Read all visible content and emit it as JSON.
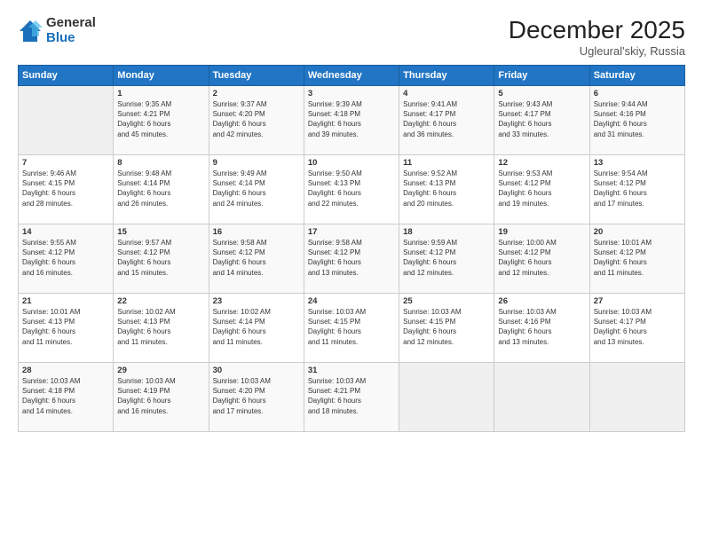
{
  "header": {
    "logo_general": "General",
    "logo_blue": "Blue",
    "title": "December 2025",
    "subtitle": "Ugleural'skiy, Russia"
  },
  "columns": [
    "Sunday",
    "Monday",
    "Tuesday",
    "Wednesday",
    "Thursday",
    "Friday",
    "Saturday"
  ],
  "rows": [
    [
      {
        "num": "",
        "info": ""
      },
      {
        "num": "1",
        "info": "Sunrise: 9:35 AM\nSunset: 4:21 PM\nDaylight: 6 hours\nand 45 minutes."
      },
      {
        "num": "2",
        "info": "Sunrise: 9:37 AM\nSunset: 4:20 PM\nDaylight: 6 hours\nand 42 minutes."
      },
      {
        "num": "3",
        "info": "Sunrise: 9:39 AM\nSunset: 4:18 PM\nDaylight: 6 hours\nand 39 minutes."
      },
      {
        "num": "4",
        "info": "Sunrise: 9:41 AM\nSunset: 4:17 PM\nDaylight: 6 hours\nand 36 minutes."
      },
      {
        "num": "5",
        "info": "Sunrise: 9:43 AM\nSunset: 4:17 PM\nDaylight: 6 hours\nand 33 minutes."
      },
      {
        "num": "6",
        "info": "Sunrise: 9:44 AM\nSunset: 4:16 PM\nDaylight: 6 hours\nand 31 minutes."
      }
    ],
    [
      {
        "num": "7",
        "info": "Sunrise: 9:46 AM\nSunset: 4:15 PM\nDaylight: 6 hours\nand 28 minutes."
      },
      {
        "num": "8",
        "info": "Sunrise: 9:48 AM\nSunset: 4:14 PM\nDaylight: 6 hours\nand 26 minutes."
      },
      {
        "num": "9",
        "info": "Sunrise: 9:49 AM\nSunset: 4:14 PM\nDaylight: 6 hours\nand 24 minutes."
      },
      {
        "num": "10",
        "info": "Sunrise: 9:50 AM\nSunset: 4:13 PM\nDaylight: 6 hours\nand 22 minutes."
      },
      {
        "num": "11",
        "info": "Sunrise: 9:52 AM\nSunset: 4:13 PM\nDaylight: 6 hours\nand 20 minutes."
      },
      {
        "num": "12",
        "info": "Sunrise: 9:53 AM\nSunset: 4:12 PM\nDaylight: 6 hours\nand 19 minutes."
      },
      {
        "num": "13",
        "info": "Sunrise: 9:54 AM\nSunset: 4:12 PM\nDaylight: 6 hours\nand 17 minutes."
      }
    ],
    [
      {
        "num": "14",
        "info": "Sunrise: 9:55 AM\nSunset: 4:12 PM\nDaylight: 6 hours\nand 16 minutes."
      },
      {
        "num": "15",
        "info": "Sunrise: 9:57 AM\nSunset: 4:12 PM\nDaylight: 6 hours\nand 15 minutes."
      },
      {
        "num": "16",
        "info": "Sunrise: 9:58 AM\nSunset: 4:12 PM\nDaylight: 6 hours\nand 14 minutes."
      },
      {
        "num": "17",
        "info": "Sunrise: 9:58 AM\nSunset: 4:12 PM\nDaylight: 6 hours\nand 13 minutes."
      },
      {
        "num": "18",
        "info": "Sunrise: 9:59 AM\nSunset: 4:12 PM\nDaylight: 6 hours\nand 12 minutes."
      },
      {
        "num": "19",
        "info": "Sunrise: 10:00 AM\nSunset: 4:12 PM\nDaylight: 6 hours\nand 12 minutes."
      },
      {
        "num": "20",
        "info": "Sunrise: 10:01 AM\nSunset: 4:12 PM\nDaylight: 6 hours\nand 11 minutes."
      }
    ],
    [
      {
        "num": "21",
        "info": "Sunrise: 10:01 AM\nSunset: 4:13 PM\nDaylight: 6 hours\nand 11 minutes."
      },
      {
        "num": "22",
        "info": "Sunrise: 10:02 AM\nSunset: 4:13 PM\nDaylight: 6 hours\nand 11 minutes."
      },
      {
        "num": "23",
        "info": "Sunrise: 10:02 AM\nSunset: 4:14 PM\nDaylight: 6 hours\nand 11 minutes."
      },
      {
        "num": "24",
        "info": "Sunrise: 10:03 AM\nSunset: 4:15 PM\nDaylight: 6 hours\nand 11 minutes."
      },
      {
        "num": "25",
        "info": "Sunrise: 10:03 AM\nSunset: 4:15 PM\nDaylight: 6 hours\nand 12 minutes."
      },
      {
        "num": "26",
        "info": "Sunrise: 10:03 AM\nSunset: 4:16 PM\nDaylight: 6 hours\nand 13 minutes."
      },
      {
        "num": "27",
        "info": "Sunrise: 10:03 AM\nSunset: 4:17 PM\nDaylight: 6 hours\nand 13 minutes."
      }
    ],
    [
      {
        "num": "28",
        "info": "Sunrise: 10:03 AM\nSunset: 4:18 PM\nDaylight: 6 hours\nand 14 minutes."
      },
      {
        "num": "29",
        "info": "Sunrise: 10:03 AM\nSunset: 4:19 PM\nDaylight: 6 hours\nand 16 minutes."
      },
      {
        "num": "30",
        "info": "Sunrise: 10:03 AM\nSunset: 4:20 PM\nDaylight: 6 hours\nand 17 minutes."
      },
      {
        "num": "31",
        "info": "Sunrise: 10:03 AM\nSunset: 4:21 PM\nDaylight: 6 hours\nand 18 minutes."
      },
      {
        "num": "",
        "info": ""
      },
      {
        "num": "",
        "info": ""
      },
      {
        "num": "",
        "info": ""
      }
    ]
  ]
}
